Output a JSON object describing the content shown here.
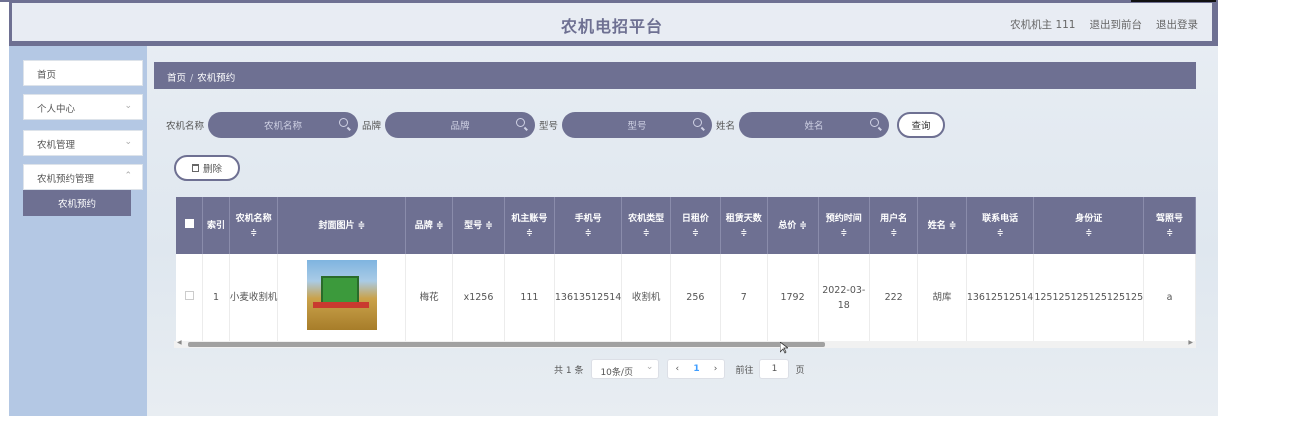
{
  "header": {
    "title": "农机电招平台",
    "user": "农机机主 111",
    "back_link": "退出到前台",
    "logout_link": "退出登录"
  },
  "sidebar": {
    "items": [
      {
        "label": "首页"
      },
      {
        "label": "个人中心"
      },
      {
        "label": "农机管理"
      },
      {
        "label": "农机预约管理"
      }
    ],
    "sub_item": "农机预约"
  },
  "breadcrumb": {
    "home": "首页",
    "current": "农机预约"
  },
  "search": {
    "fields": [
      {
        "label": "农机名称",
        "placeholder": "农机名称"
      },
      {
        "label": "品牌",
        "placeholder": "品牌"
      },
      {
        "label": "型号",
        "placeholder": "型号"
      },
      {
        "label": "姓名",
        "placeholder": "姓名"
      }
    ],
    "query_button": "查询"
  },
  "toolbar": {
    "delete_button": "删除"
  },
  "table": {
    "columns": [
      "索引",
      "农机名称",
      "封面图片",
      "品牌",
      "型号",
      "机主账号",
      "手机号",
      "农机类型",
      "日租价",
      "租赁天数",
      "总价",
      "预约时间",
      "用户名",
      "姓名",
      "联系电话",
      "身份证",
      "驾照号"
    ],
    "rows": [
      {
        "index": "1",
        "name": "小麦收割机",
        "brand": "梅花",
        "model": "x1256",
        "owner": "111",
        "phone": "13613512514",
        "type": "收割机",
        "daily_price": "256",
        "days": "7",
        "total": "1792",
        "time": "2022-03-18",
        "username": "222",
        "realname": "胡库",
        "contact": "13612512514",
        "idcard": "125125125125125125",
        "license": "a"
      }
    ]
  },
  "pagination": {
    "total": "共 1 条",
    "page_size": "10条/页",
    "current": "1",
    "goto_label": "前往",
    "goto_value": "1",
    "page_suffix": "页"
  },
  "colors": {
    "primary": "#6e7092",
    "sidebar": "#b4c8e4"
  }
}
